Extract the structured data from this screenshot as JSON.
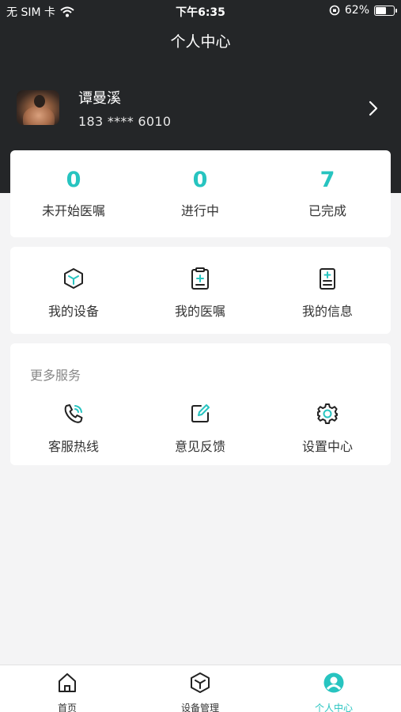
{
  "status_bar": {
    "carrier": "无 SIM 卡",
    "time": "下午6:35",
    "battery": "62%",
    "battery_level": 0.62
  },
  "header": {
    "title": "个人中心"
  },
  "profile": {
    "name": "谭曼溪",
    "phone": "183 **** 6010"
  },
  "stats": [
    {
      "value": "0",
      "label": "未开始医嘱"
    },
    {
      "value": "0",
      "label": "进行中"
    },
    {
      "value": "7",
      "label": "已完成"
    }
  ],
  "services": [
    {
      "label": "我的设备",
      "icon": "cube-icon"
    },
    {
      "label": "我的医嘱",
      "icon": "clipboard-plus-icon"
    },
    {
      "label": "我的信息",
      "icon": "document-plus-icon"
    }
  ],
  "more": {
    "title": "更多服务",
    "items": [
      {
        "label": "客服热线",
        "icon": "phone-icon"
      },
      {
        "label": "意见反馈",
        "icon": "edit-icon"
      },
      {
        "label": "设置中心",
        "icon": "gear-icon"
      }
    ]
  },
  "tabbar": {
    "tabs": [
      {
        "label": "首页",
        "icon": "home-icon",
        "active": false
      },
      {
        "label": "设备管理",
        "icon": "cube-icon",
        "active": false
      },
      {
        "label": "个人中心",
        "icon": "user-icon",
        "active": true
      }
    ]
  },
  "colors": {
    "accent": "#27c4c0",
    "header_bg": "#242628",
    "page_bg": "#f4f4f5"
  }
}
